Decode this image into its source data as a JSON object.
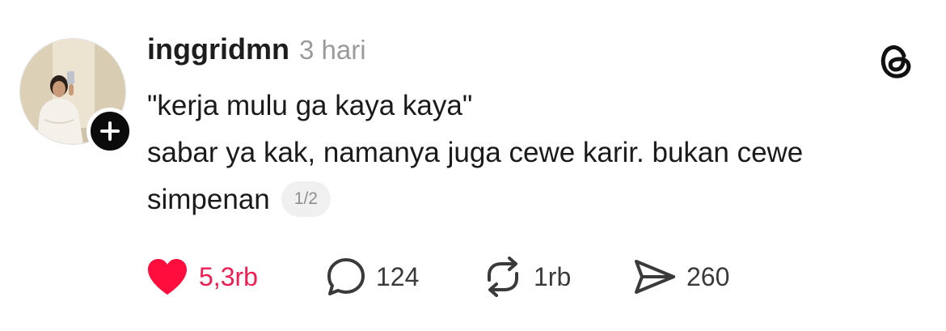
{
  "post": {
    "username": "inggridmn",
    "timestamp": "3 hari",
    "quote_line": "\"kerja mulu ga kaya kaya\"",
    "body_text": "sabar ya kak, namanya juga cewe karir. bukan cewe simpenan",
    "page_indicator": "1/2"
  },
  "actions": {
    "likes": "5,3rb",
    "replies": "124",
    "reposts": "1rb",
    "shares": "260"
  },
  "icons": {
    "like": "heart-icon",
    "reply": "speech-bubble-icon",
    "repost": "repost-arrows-icon",
    "share": "send-icon",
    "follow": "plus-icon",
    "app": "threads-logo-icon"
  },
  "colors": {
    "like_active": "#ee1d52",
    "text": "#1a1a1a",
    "muted": "#9a9a9a",
    "badge": "#0b0b0b"
  }
}
